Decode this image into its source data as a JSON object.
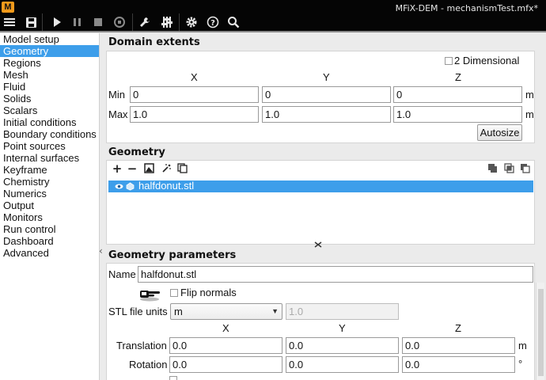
{
  "app": {
    "logo": "M",
    "title": "MFiX-DEM - mechanismTest.mfx*"
  },
  "toolbar": {
    "icons": [
      "menu-icon",
      "save-icon",
      "run-icon",
      "pause-icon",
      "stop-icon",
      "reset-icon",
      "wrench-icon",
      "sliders-icon",
      "gear-icon",
      "help-icon",
      "search-icon"
    ]
  },
  "sidebar": {
    "items": [
      {
        "label": "Model setup",
        "selected": false
      },
      {
        "label": "Geometry",
        "selected": true
      },
      {
        "label": "Regions",
        "selected": false
      },
      {
        "label": "Mesh",
        "selected": false
      },
      {
        "label": "Fluid",
        "selected": false
      },
      {
        "label": "Solids",
        "selected": false
      },
      {
        "label": "Scalars",
        "selected": false
      },
      {
        "label": "Initial conditions",
        "selected": false
      },
      {
        "label": "Boundary conditions",
        "selected": false
      },
      {
        "label": "Point sources",
        "selected": false
      },
      {
        "label": "Internal surfaces",
        "selected": false
      },
      {
        "label": "Keyframe",
        "selected": false
      },
      {
        "label": "Chemistry",
        "selected": false
      },
      {
        "label": "Numerics",
        "selected": false
      },
      {
        "label": "Output",
        "selected": false
      },
      {
        "label": "Monitors",
        "selected": false
      },
      {
        "label": "Run control",
        "selected": false
      },
      {
        "label": "Dashboard",
        "selected": false
      },
      {
        "label": "Advanced",
        "selected": false
      }
    ]
  },
  "domain": {
    "title": "Domain extents",
    "two_d_label": "2 Dimensional",
    "two_d_checked": false,
    "headers": {
      "x": "X",
      "y": "Y",
      "z": "Z"
    },
    "min_label": "Min",
    "max_label": "Max",
    "min": {
      "x": "0",
      "y": "0",
      "z": "0"
    },
    "max": {
      "x": "1.0",
      "y": "1.0",
      "z": "1.0"
    },
    "unit": "m",
    "autosize_label": "Autosize"
  },
  "geometry": {
    "title": "Geometry",
    "toolbar_left": [
      "add-icon",
      "remove-icon",
      "image-icon",
      "wand-icon",
      "copy-icon"
    ],
    "toolbar_right": [
      "union-icon",
      "intersect-icon",
      "difference-icon"
    ],
    "items": [
      {
        "name": "halfdonut.stl",
        "selected": true
      }
    ]
  },
  "params": {
    "title": "Geometry parameters",
    "name_label": "Name",
    "name_value": "halfdonut.stl",
    "flip_label": "Flip normals",
    "flip_checked": false,
    "units_label": "STL file units",
    "units_value": "m",
    "units_scale": "1.0",
    "headers": {
      "x": "X",
      "y": "Y",
      "z": "Z"
    },
    "translation_label": "Translation",
    "translation": {
      "x": "0.0",
      "y": "0.0",
      "z": "0.0"
    },
    "translation_unit": "m",
    "rotation_label": "Rotation",
    "rotation": {
      "x": "0.0",
      "y": "0.0",
      "z": "0.0"
    },
    "rotation_unit": "°"
  }
}
